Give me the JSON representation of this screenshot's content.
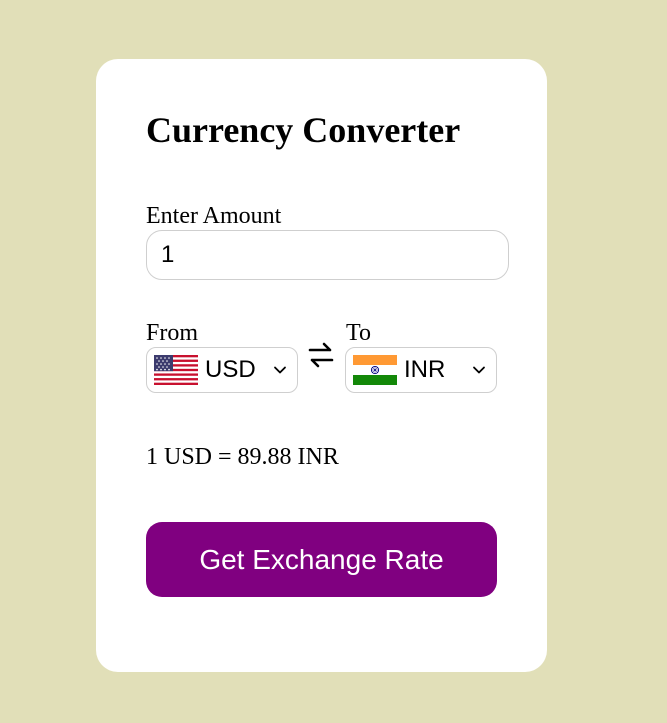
{
  "converter": {
    "title": "Currency Converter",
    "amount_label": "Enter Amount",
    "amount_value": "1",
    "from_label": "From",
    "to_label": "To",
    "from_currency": {
      "code": "USD",
      "flag": "us-flag"
    },
    "to_currency": {
      "code": "INR",
      "flag": "in-flag"
    },
    "result_text": "1 USD = 89.88 INR",
    "button_label": "Get Exchange Rate",
    "colors": {
      "page_background": "#e1dfb8",
      "card_background": "#ffffff",
      "button_background": "#800080",
      "button_text": "#ffffff"
    }
  }
}
